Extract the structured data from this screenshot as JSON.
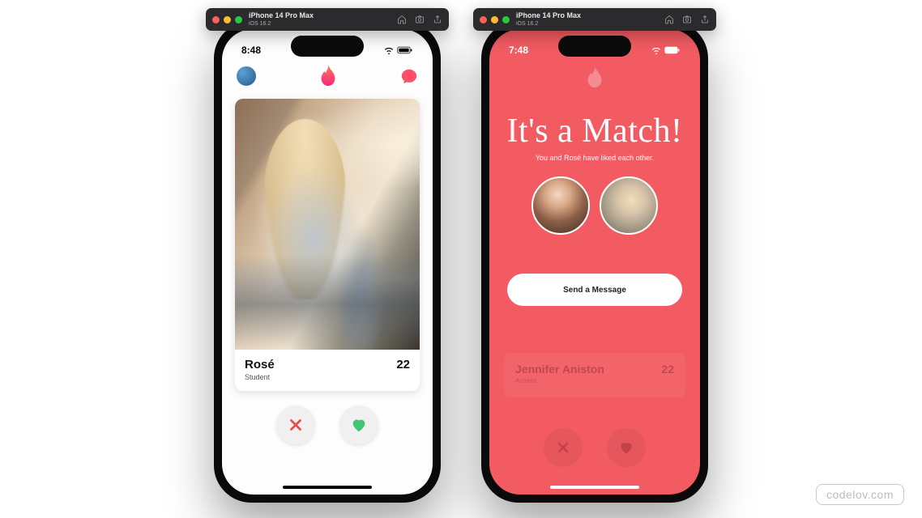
{
  "simulator": {
    "device": "iPhone 14 Pro Max",
    "os": "iOS 16.2"
  },
  "phone_left": {
    "time": "8:48",
    "card": {
      "name": "Rosé",
      "subtitle": "Student",
      "age": "22"
    }
  },
  "phone_right": {
    "time": "7:48",
    "match_title": "It's a Match!",
    "match_line": "You and Rosé have liked each other.",
    "send_button": "Send a Message",
    "ghost_card": {
      "name": "Jennifer Aniston",
      "subtitle": "Actress",
      "age": "22"
    }
  },
  "watermark": "codelov.com"
}
